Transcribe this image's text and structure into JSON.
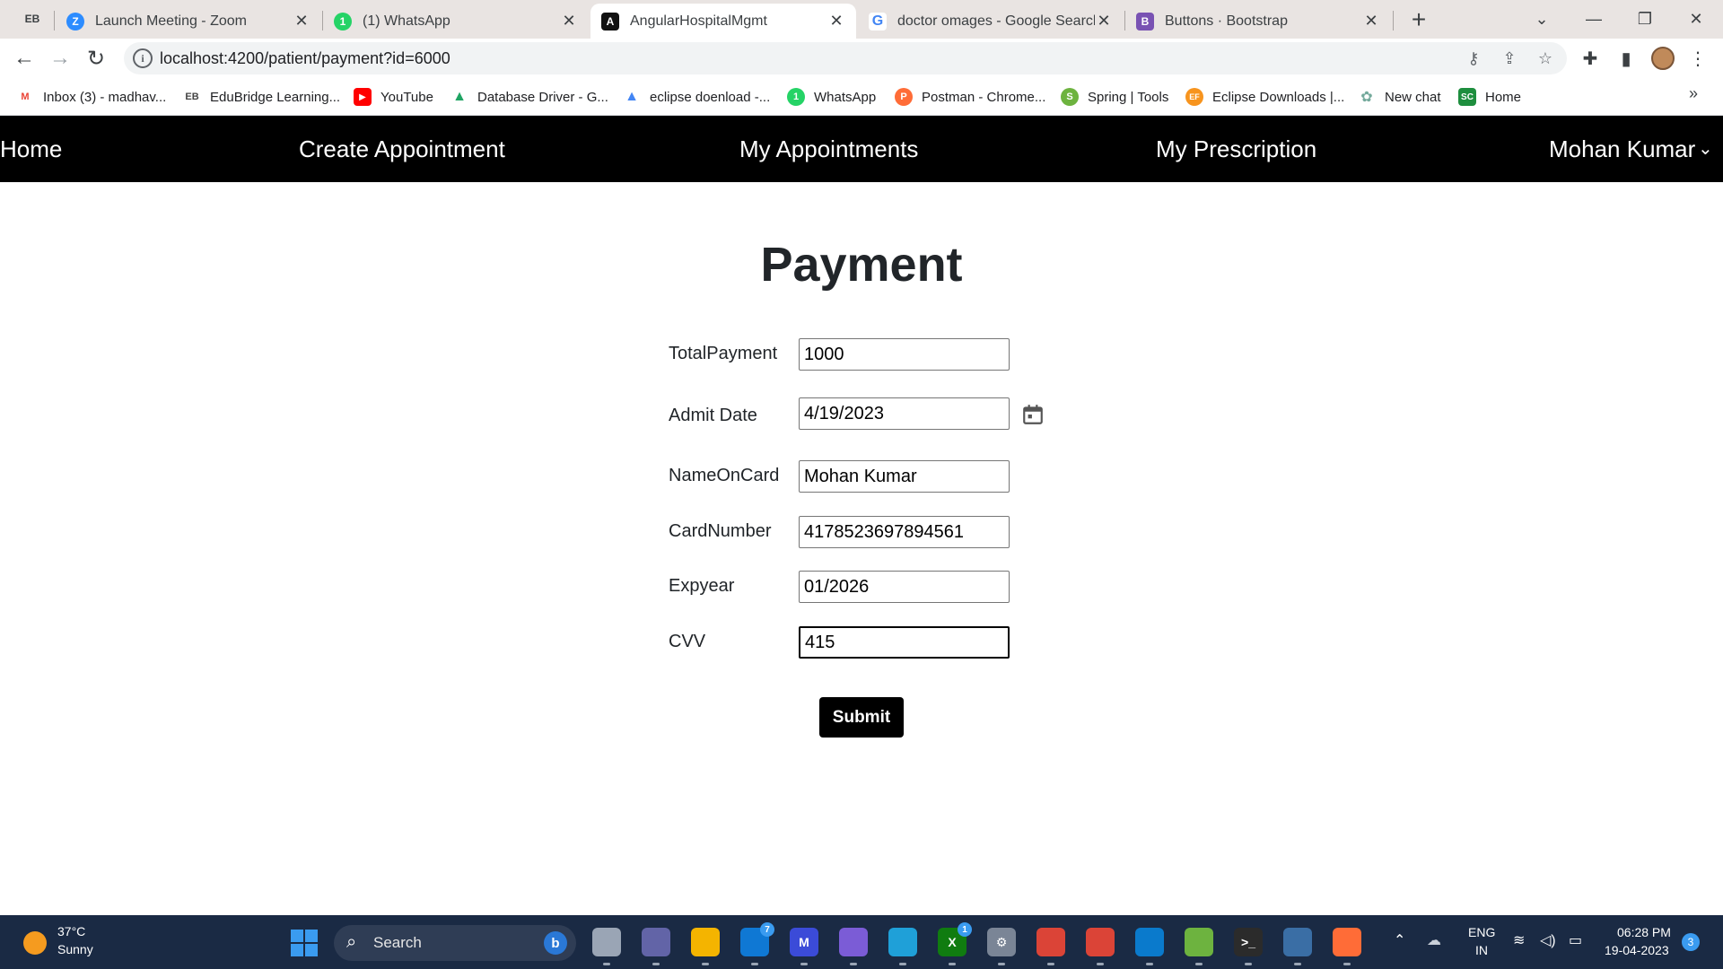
{
  "browser": {
    "tabs_button_text": "EB",
    "tabs": [
      {
        "title": "Launch Meeting - Zoom",
        "favicon_text": "Z",
        "favicon_color": "#2d8cff",
        "active": false
      },
      {
        "title": "(1) WhatsApp",
        "favicon_text": "1",
        "favicon_color": "#25d366",
        "active": false
      },
      {
        "title": "AngularHospitalMgmt",
        "favicon_text": "A",
        "favicon_color": "#111111",
        "active": true
      },
      {
        "title": "doctor omages - Google Search",
        "favicon_text": "G",
        "favicon_color": "#4285f4",
        "active": false
      },
      {
        "title": "Buttons · Bootstrap",
        "favicon_text": "B",
        "favicon_color": "#7952b3",
        "active": false
      }
    ],
    "url": "localhost:4200/patient/payment?id=6000",
    "bookmarks": [
      {
        "label": "Inbox (3) - madhav...",
        "icon": "gmail-icon",
        "icon_text": "M",
        "color": "#ea4335"
      },
      {
        "label": "EduBridge Learning...",
        "icon": "edubridge-icon",
        "icon_text": "EB",
        "color": "#444444"
      },
      {
        "label": "YouTube",
        "icon": "youtube-icon",
        "icon_text": "▶",
        "color": "#ff0000"
      },
      {
        "label": "Database Driver - G...",
        "icon": "google-drive-icon",
        "icon_text": "▲",
        "color": "#1fa463"
      },
      {
        "label": "eclipse doenload -...",
        "icon": "google-drive-icon",
        "icon_text": "▲",
        "color": "#4285f4"
      },
      {
        "label": "WhatsApp",
        "icon": "whatsapp-icon",
        "icon_text": "1",
        "color": "#25d366"
      },
      {
        "label": "Postman - Chrome...",
        "icon": "postman-icon",
        "icon_text": "P",
        "color": "#ff6c37"
      },
      {
        "label": "Spring | Tools",
        "icon": "spring-icon",
        "icon_text": "S",
        "color": "#6db33f"
      },
      {
        "label": "Eclipse Downloads |...",
        "icon": "eclipse-icon",
        "icon_text": "EF",
        "color": "#f7941e"
      },
      {
        "label": "New chat",
        "icon": "chatgpt-icon",
        "icon_text": "✿",
        "color": "#74aa9c"
      },
      {
        "label": "Home",
        "icon": "home-sc-icon",
        "icon_text": "SC",
        "color": "#1e8e3e"
      }
    ]
  },
  "app": {
    "nav": {
      "home": "Home",
      "create_appointment": "Create Appointment",
      "my_appointments": "My Appointments",
      "my_prescription": "My Prescription",
      "user": "Mohan Kumar"
    },
    "title": "Payment",
    "form": {
      "total_payment": {
        "label": "TotalPayment",
        "value": "1000"
      },
      "admit_date": {
        "label": "Admit Date",
        "value": "4/19/2023"
      },
      "name_on_card": {
        "label": "NameOnCard",
        "value": "Mohan Kumar"
      },
      "card_number": {
        "label": "CardNumber",
        "value": "4178523697894561"
      },
      "exp_year": {
        "label": "Expyear",
        "value": "01/2026"
      },
      "cvv": {
        "label": "CVV",
        "value": "415"
      },
      "submit_label": "Submit"
    }
  },
  "taskbar": {
    "weather_temp": "37°C",
    "weather_desc": "Sunny",
    "search_label": "Search",
    "apps": [
      {
        "name": "task-view-icon",
        "color": "#9aa5b5",
        "text": "",
        "badge": ""
      },
      {
        "name": "teams-icon",
        "color": "#6264a7",
        "text": "",
        "badge": ""
      },
      {
        "name": "file-explorer-icon",
        "color": "#f4b400",
        "text": "",
        "badge": ""
      },
      {
        "name": "mail-icon",
        "color": "#0f78d4",
        "text": "",
        "badge": "7"
      },
      {
        "name": "pen-app-icon",
        "color": "#3b4bd8",
        "text": "M",
        "badge": ""
      },
      {
        "name": "copilot-icon",
        "color": "#7b5cd6",
        "text": "",
        "badge": ""
      },
      {
        "name": "edge-icon",
        "color": "#1fa0d8",
        "text": "",
        "badge": ""
      },
      {
        "name": "xbox-icon",
        "color": "#107c10",
        "text": "X",
        "badge": "1"
      },
      {
        "name": "settings-icon",
        "color": "#7a8596",
        "text": "⚙",
        "badge": ""
      },
      {
        "name": "chrome-icon",
        "color": "#db4437",
        "text": "",
        "badge": ""
      },
      {
        "name": "chrome-profile-icon",
        "color": "#db4437",
        "text": "",
        "badge": ""
      },
      {
        "name": "vscode-icon",
        "color": "#0a7acc",
        "text": "",
        "badge": ""
      },
      {
        "name": "spring-tools-icon",
        "color": "#6db33f",
        "text": "",
        "badge": ""
      },
      {
        "name": "terminal-icon",
        "color": "#2b2b2b",
        "text": ">_",
        "badge": ""
      },
      {
        "name": "mysql-workbench-icon",
        "color": "#3a6ea5",
        "text": "",
        "badge": ""
      },
      {
        "name": "postman-app-icon",
        "color": "#ff6c37",
        "text": "",
        "badge": ""
      }
    ],
    "lang_line1": "ENG",
    "lang_line2": "IN",
    "time": "06:28 PM",
    "date": "19-04-2023",
    "notifications": "3"
  }
}
